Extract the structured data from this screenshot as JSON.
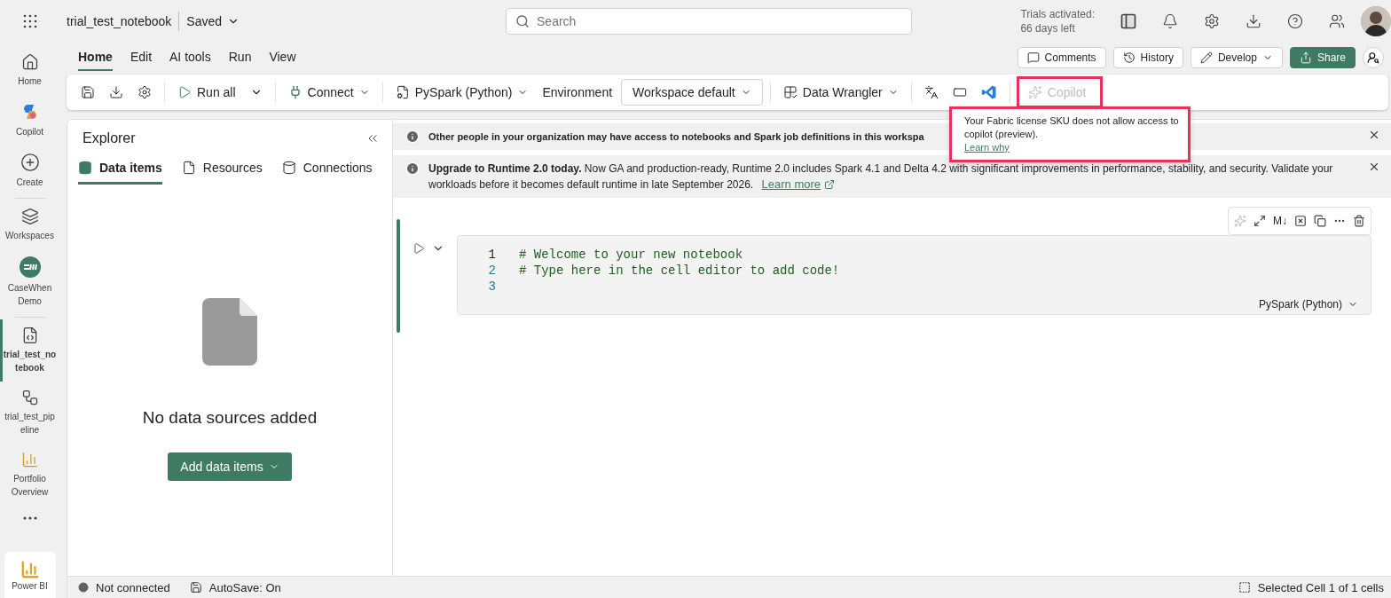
{
  "top_bar": {
    "title": "trial_test_notebook",
    "save_status": "Saved",
    "search": {
      "placeholder": "Search"
    },
    "trial_lines": [
      "Trials activated:",
      "66 days left"
    ]
  },
  "nav_rail": {
    "items": [
      {
        "label": "Home",
        "kind": "home",
        "selected": false
      },
      {
        "label": "Copilot",
        "kind": "copilot",
        "selected": false
      },
      {
        "label": "Create",
        "kind": "create",
        "selected": false
      },
      {
        "label": "Workspaces",
        "kind": "workspaces",
        "selected": false
      },
      {
        "label": "CaseWhen Demo",
        "kind": "workspace",
        "selected": false
      },
      {
        "label": "trial_test_notebook",
        "kind": "notebook",
        "selected": true
      },
      {
        "label": "trial_test_pipeline",
        "kind": "pipeline",
        "selected": false
      },
      {
        "label": "Portfolio Overview",
        "kind": "report",
        "selected": false
      }
    ],
    "footer": "Power BI"
  },
  "ribbon_tabs": [
    {
      "label": "Home",
      "selected": true
    },
    {
      "label": "Edit",
      "selected": false
    },
    {
      "label": "AI tools",
      "selected": false
    },
    {
      "label": "Run",
      "selected": false
    },
    {
      "label": "View",
      "selected": false
    }
  ],
  "actions": [
    {
      "label": "Comments",
      "kind": "comments"
    },
    {
      "label": "History",
      "kind": "history"
    },
    {
      "label": "Develop",
      "kind": "develop"
    },
    {
      "label": "Share",
      "kind": "share"
    }
  ],
  "toolbar": {
    "run_all": "Run all",
    "connect": "Connect",
    "language": "PySpark (Python)",
    "environment_label": "Environment",
    "environment": "Workspace default",
    "data_wrangler": "Data Wrangler",
    "copilot": {
      "label": "Copilot",
      "disabled": true
    }
  },
  "tooltip": {
    "text": "Your Fabric license SKU does not allow access to copilot (preview).",
    "link": "Learn why"
  },
  "explorer": {
    "title": "Explorer",
    "tabs": [
      {
        "label": "Data items",
        "kind": "data",
        "selected": true
      },
      {
        "label": "Resources",
        "kind": "resources",
        "selected": false
      },
      {
        "label": "Connections",
        "kind": "connections",
        "selected": false
      }
    ],
    "empty_message": "No data sources added",
    "add_button": "Add data items"
  },
  "banners": [
    {
      "text": "**Other people in your organization may have access to notebooks and Spark job definitions in this workspa**"
    },
    {
      "text": "**Upgrade to Runtime 2.0 today.** Now GA and production-ready, Runtime 2.0 includes Spark 4.1 and Delta 4.2 with significant improvements in performance, stability, and security. Validate your workloads before it becomes default runtime in late September 2026.",
      "link": "Learn more"
    }
  ],
  "cell": {
    "markdown_toggle": "M↓",
    "lines": [
      {
        "number": "1",
        "code": "# Welcome to your new notebook",
        "active": true
      },
      {
        "number": "2",
        "code": "# Type here in the cell editor to add code!",
        "active": false
      },
      {
        "number": "3",
        "active": false
      }
    ],
    "language": "PySpark (Python)"
  },
  "status_bar": {
    "connection": "Not connected",
    "autosave": "AutoSave: On",
    "selection": "Selected Cell 1 of 1 cells"
  }
}
